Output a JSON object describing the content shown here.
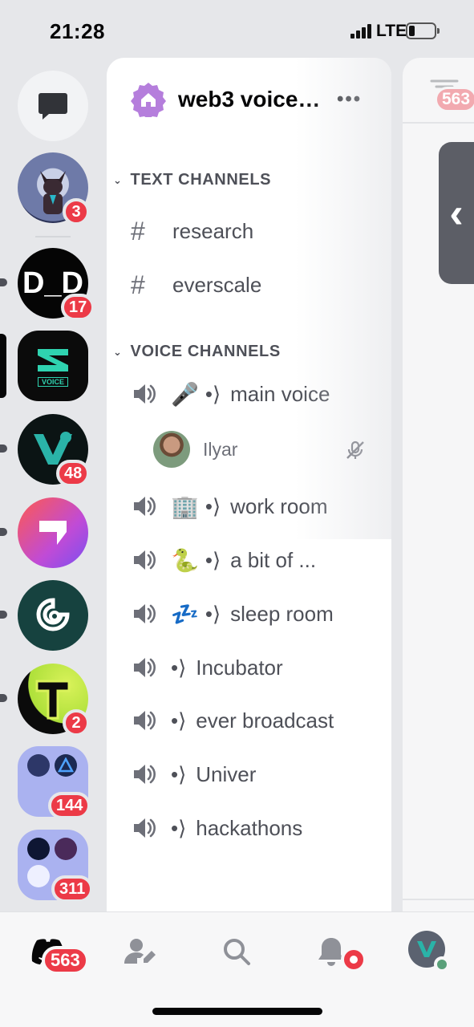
{
  "status_bar": {
    "time": "21:28",
    "network": "LTE"
  },
  "rail": {
    "guilds": [
      {
        "name": "cat-server",
        "badge": "3"
      },
      {
        "name": "d-d-server",
        "text": "D_D",
        "badge": "17"
      },
      {
        "name": "voice-server",
        "text": "VOICE",
        "badge": ""
      },
      {
        "name": "v-server",
        "badge": "48"
      },
      {
        "name": "arrow-server",
        "badge": ""
      },
      {
        "name": "helmet-server",
        "badge": ""
      },
      {
        "name": "t-server",
        "badge": "2"
      },
      {
        "name": "folder-1",
        "badge": "144"
      },
      {
        "name": "folder-2",
        "badge": "311"
      }
    ]
  },
  "server": {
    "name": "web3 voice…",
    "more": "•••"
  },
  "categories": {
    "text": "TEXT CHANNELS",
    "voice": "VOICE CHANNELS"
  },
  "text_channels": [
    {
      "name": "research"
    },
    {
      "name": "everscale"
    }
  ],
  "voice_channels": [
    {
      "emoji": "🎤",
      "prefix": "•⟩",
      "name": "main voice"
    },
    {
      "emoji": "🏢",
      "prefix": "•⟩",
      "name": "work room"
    },
    {
      "emoji": "🐍",
      "prefix": "•⟩",
      "name": "a bit of ..."
    },
    {
      "emoji": "💤",
      "prefix": "•⟩",
      "name": "sleep room"
    },
    {
      "emoji": "",
      "prefix": "•⟩",
      "name": "Incubator"
    },
    {
      "emoji": "",
      "prefix": "•⟩",
      "name": "ever broadcast"
    },
    {
      "emoji": "",
      "prefix": "•⟩",
      "name": "Univer"
    },
    {
      "emoji": "",
      "prefix": "•⟩",
      "name": "hackathons"
    }
  ],
  "voice_user": {
    "name": "Ilyar"
  },
  "right_peek": {
    "badge": "563"
  },
  "tabbar": {
    "home_badge": "563"
  },
  "colors": {
    "badge": "#ec3a47",
    "accent": "#5865f2",
    "server_icon": "#b57edc"
  }
}
